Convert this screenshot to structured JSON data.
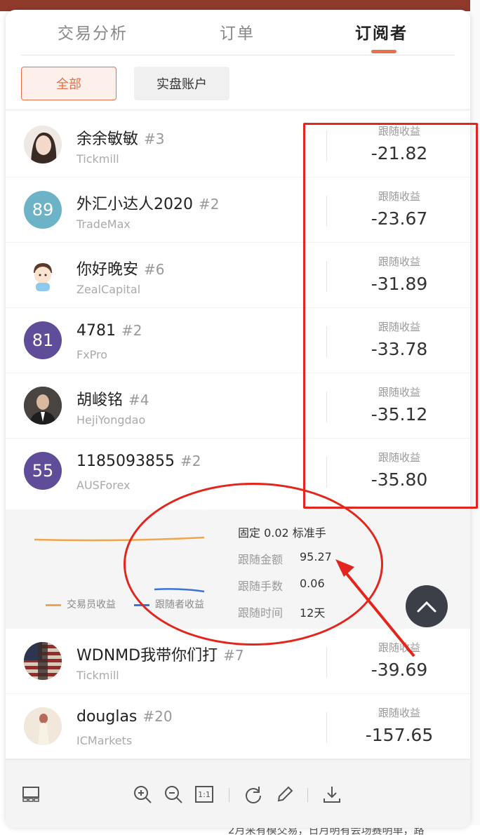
{
  "tabs": [
    {
      "label": "交易分析"
    },
    {
      "label": "订单"
    },
    {
      "label": "订阅者"
    }
  ],
  "filters": {
    "all_label": "全部",
    "real_label": "实盘账户"
  },
  "rows": [
    {
      "name": "余余敏敏",
      "rank": "#3",
      "broker": "Tickmill",
      "return_label": "跟随收益",
      "return": "-21.82",
      "avatar_type": "photo"
    },
    {
      "name": "外汇小达人2020",
      "rank": "#2",
      "broker": "TradeMax",
      "return_label": "跟随收益",
      "return": "-23.67",
      "avatar_text": "89",
      "avatar_color": "#6cb3c7"
    },
    {
      "name": "你好晚安",
      "rank": "#6",
      "broker": "ZealCapital",
      "return_label": "跟随收益",
      "return": "-31.89",
      "avatar_type": "cartoon"
    },
    {
      "name": "4781",
      "rank": "#2",
      "broker": "FxPro",
      "return_label": "跟随收益",
      "return": "-33.78",
      "avatar_text": "81",
      "avatar_color": "#5f4d9a"
    },
    {
      "name": "胡峻铭",
      "rank": "#4",
      "broker": "HejiYongdao",
      "return_label": "跟随收益",
      "return": "-35.12",
      "avatar_type": "photo"
    },
    {
      "name": "1185093855",
      "rank": "#2",
      "broker": "AUSForex",
      "return_label": "跟随收益",
      "return": "-35.80",
      "avatar_text": "55",
      "avatar_color": "#5f4d9a"
    },
    {
      "name": "WDNMD我带你们打",
      "rank": "#7",
      "broker": "Tickmill",
      "return_label": "跟随收益",
      "return": "-39.69",
      "avatar_type": "flag"
    },
    {
      "name": "douglas",
      "rank": "#20",
      "broker": "ICMarkets",
      "return_label": "跟随收益",
      "return": "-157.65",
      "avatar_type": "photo"
    }
  ],
  "detail": {
    "mode": "固定 0.02 标准手",
    "amount_label": "跟随金额",
    "amount": "95.27",
    "lots_label": "跟随手数",
    "lots": "0.06",
    "time_label": "跟随时间",
    "time": "12天",
    "legend_trader": "交易员收益",
    "legend_follower": "跟随者收益",
    "trader_color": "#f0a44b",
    "follower_color": "#3b73d6"
  },
  "bottom_text": "2月采有模交易，日月明有会场赛明单，路",
  "colors": {
    "accent": "#e8704a",
    "annotation": "#e4251c"
  },
  "toolbar_icons": [
    "layout-icon",
    "zoom-in-icon",
    "zoom-out-icon",
    "actual-size-icon",
    "rotate-icon",
    "edit-pen-icon",
    "download-icon"
  ],
  "actual_size_label": "1:1"
}
